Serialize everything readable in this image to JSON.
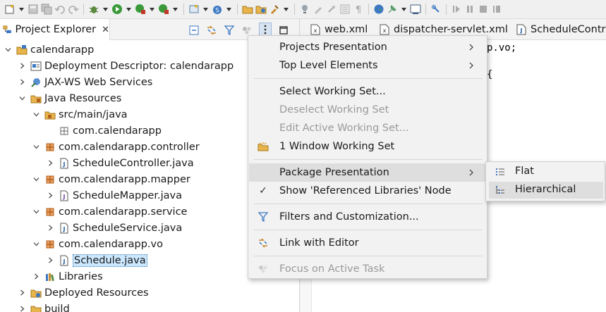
{
  "toolbar": {
    "icons": [
      "new-icon",
      "save-icon",
      "save-all-icon",
      "undo-icon",
      "redo-icon",
      "debug-icon",
      "run-icon",
      "run-coverage-icon",
      "external-tools-icon",
      "new-server-icon",
      "new-java-class-icon",
      "open-type-icon",
      "search-icon",
      "task-icon",
      "toggle-mark-icon",
      "show-whitespace-icon",
      "block-selection-icon",
      "web-browser-icon",
      "pin-icon",
      "console-icon",
      "breakpoint-icon",
      "resume-icon",
      "suspend-icon",
      "terminate-icon",
      "step-icon"
    ]
  },
  "explorer": {
    "tab_label": "Project Explorer",
    "tab_close": "✕"
  },
  "tree": [
    {
      "label": "calendarapp",
      "icon": "project-icon",
      "expanded": true
    },
    {
      "label": "Deployment Descriptor: calendarapp",
      "icon": "deployment-descriptor-icon",
      "expanded": false
    },
    {
      "label": "JAX-WS Web Services",
      "icon": "web-services-icon",
      "expanded": false
    },
    {
      "label": "Java Resources",
      "icon": "java-resources-icon",
      "expanded": true
    },
    {
      "label": "src/main/java",
      "icon": "source-folder-icon",
      "expanded": true
    },
    {
      "label": "com.calendarapp",
      "icon": "empty-package-icon",
      "expanded": null
    },
    {
      "label": "com.calendarapp.controller",
      "icon": "package-icon",
      "expanded": true
    },
    {
      "label": "ScheduleController.java",
      "icon": "java-file-icon",
      "expanded": false
    },
    {
      "label": "com.calendarapp.mapper",
      "icon": "package-icon",
      "expanded": true
    },
    {
      "label": "ScheduleMapper.java",
      "icon": "java-interface-file-icon",
      "expanded": false
    },
    {
      "label": "com.calendarapp.service",
      "icon": "package-icon",
      "expanded": true
    },
    {
      "label": "ScheduleService.java",
      "icon": "java-file-icon",
      "expanded": false
    },
    {
      "label": "com.calendarapp.vo",
      "icon": "package-icon",
      "expanded": true
    },
    {
      "label": "Schedule.java",
      "icon": "java-file-icon",
      "expanded": false,
      "selected": true
    },
    {
      "label": "Libraries",
      "icon": "libraries-icon",
      "expanded": false
    },
    {
      "label": "Deployed Resources",
      "icon": "deployed-resources-icon",
      "expanded": false
    },
    {
      "label": "build",
      "icon": "folder-icon",
      "expanded": false
    }
  ],
  "editor": {
    "tabs": [
      {
        "label": "web.xml",
        "icon": "xml-file-icon"
      },
      {
        "label": "dispatcher-servlet.xml",
        "icon": "xml-file-icon"
      },
      {
        "label": "ScheduleContro",
        "icon": "java-file-icon"
      }
    ],
    "code_lines": [
      "p.vo;",
      "{"
    ]
  },
  "menu": {
    "items": [
      {
        "label": "Projects Presentation",
        "submenu": true,
        "enabled": true
      },
      {
        "label": "Top Level Elements",
        "submenu": true,
        "enabled": true
      },
      {
        "label": "Select Working Set...",
        "enabled": true
      },
      {
        "label": "Deselect Working Set",
        "enabled": false
      },
      {
        "label": "Edit Active Working Set...",
        "enabled": false
      },
      {
        "label": "1 Window Working Set",
        "enabled": true,
        "icon": "working-set-icon"
      },
      {
        "label": "Package Presentation",
        "submenu": true,
        "enabled": true,
        "hover": true
      },
      {
        "label": "Show 'Referenced Libraries' Node",
        "enabled": true,
        "checked": true
      },
      {
        "label": "Filters and Customization...",
        "enabled": true,
        "icon": "filter-icon"
      },
      {
        "label": "Link with Editor",
        "enabled": true,
        "icon": "link-editor-icon"
      },
      {
        "label": "Focus on Active Task",
        "enabled": false,
        "icon": "focus-task-icon"
      }
    ],
    "check_mark": "✓"
  },
  "submenu": {
    "items": [
      {
        "label": "Flat",
        "icon": "flat-list-icon"
      },
      {
        "label": "Hierarchical",
        "icon": "hierarchical-list-icon",
        "hover": true
      }
    ]
  },
  "colors": {
    "accent": "#1e5aa0",
    "package": "#b5611e",
    "folder": "#e8b44c",
    "selection": "#cce8ff"
  }
}
